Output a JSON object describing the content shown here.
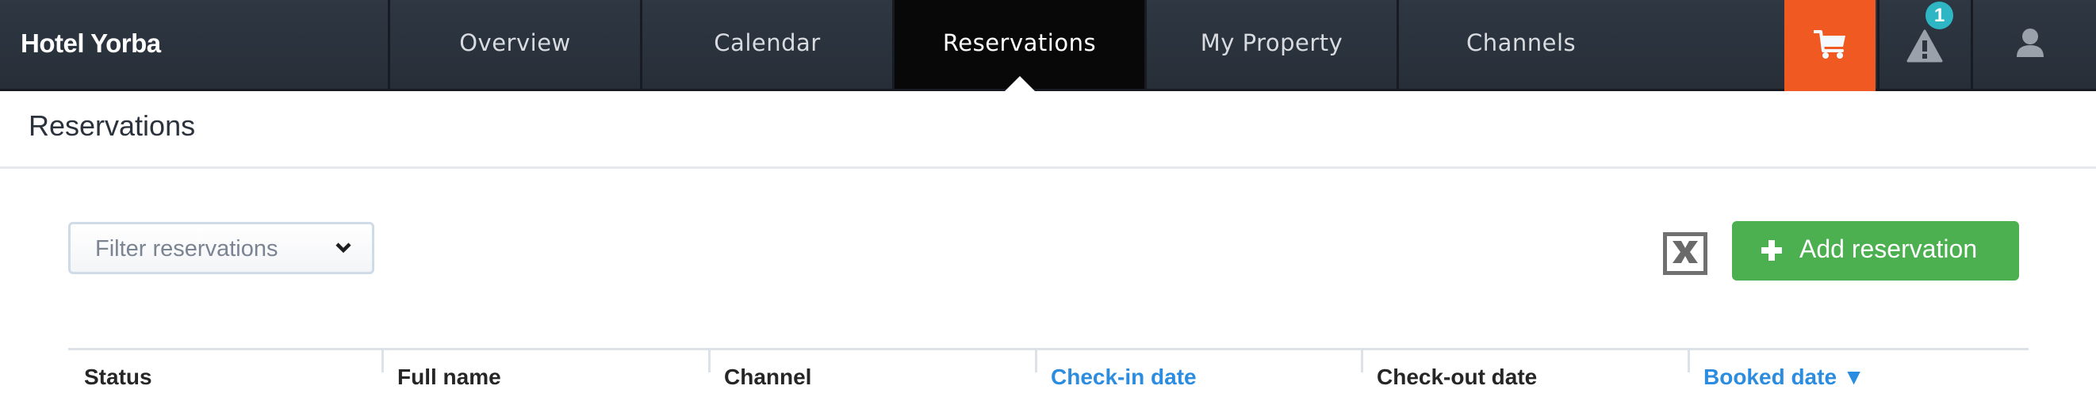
{
  "app": {
    "brand": "Hotel Yorba"
  },
  "nav": {
    "tabs": [
      {
        "label": "Overview",
        "active": false
      },
      {
        "label": "Calendar",
        "active": false
      },
      {
        "label": "Reservations",
        "active": true
      },
      {
        "label": "My Property",
        "active": false
      },
      {
        "label": "Channels",
        "active": false
      }
    ],
    "cart_icon": "shopping-cart-icon",
    "alert_icon": "warning-triangle-icon",
    "alert_count": "1",
    "user_icon": "user-icon"
  },
  "page": {
    "title": "Reservations"
  },
  "toolbar": {
    "filter_placeholder": "Filter reservations",
    "export_icon": "excel-export-icon",
    "add_label": "Add reservation"
  },
  "table": {
    "columns": [
      {
        "label": "Status",
        "sortable": false
      },
      {
        "label": "Full name",
        "sortable": false
      },
      {
        "label": "Channel",
        "sortable": false
      },
      {
        "label": "Check-in date",
        "sortable": true
      },
      {
        "label": "Check-out date",
        "sortable": false
      },
      {
        "label": "Booked date ▼",
        "sortable": true,
        "sorted": "desc"
      }
    ]
  },
  "colors": {
    "nav_bg": "#2b333e",
    "active_tab": "#080808",
    "cart_accent": "#f05a22",
    "badge": "#2fb6c4",
    "primary_button": "#4caf50",
    "link": "#2b8ce0"
  }
}
